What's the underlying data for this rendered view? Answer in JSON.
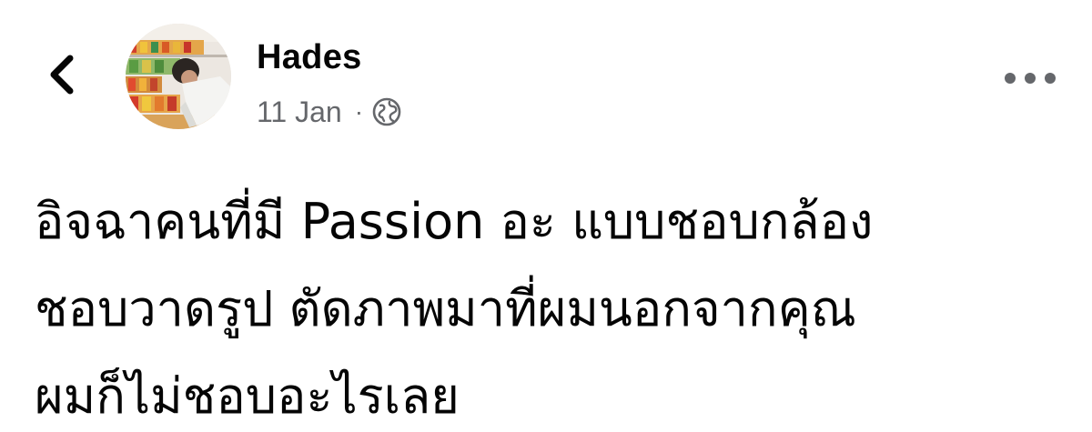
{
  "header": {
    "back_icon": "chevron-left-icon",
    "more_icon": "three-dots-icon"
  },
  "post": {
    "author": "Hades",
    "date": "11 Jan",
    "separator": "·",
    "privacy_icon": "globe-icon",
    "text_lines": [
      "อิจฉาคนที่มี Passion อะ แบบชอบกล้อง",
      "ชอบวาดรูป ตัดภาพมาที่ผมนอกจากคุณ",
      "ผมก็ไม่ชอบอะไรเลย"
    ]
  },
  "colors": {
    "text": "#050505",
    "secondary": "#65676b",
    "background": "#ffffff"
  }
}
